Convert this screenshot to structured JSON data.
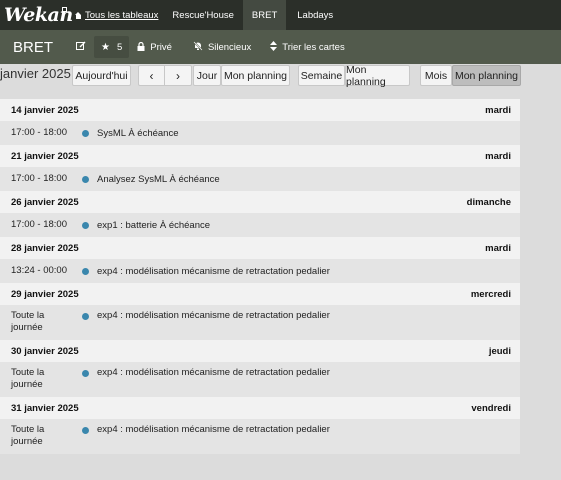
{
  "header": {
    "logo": "Wekan",
    "links": [
      {
        "label": "Tous les tableaux"
      },
      {
        "label": "Rescue'House"
      },
      {
        "label": "BRET"
      },
      {
        "label": "Labdays"
      }
    ]
  },
  "board": {
    "title": "BRET",
    "stars": "5",
    "private_label": "Privé",
    "silent_label": "Silencieux",
    "sort_label": "Trier les cartes"
  },
  "calendar": {
    "title": "janvier 2025",
    "today_label": "Aujourd'hui",
    "prev_icon": "chevron-left-icon",
    "next_icon": "chevron-right-icon",
    "day_label": "Jour",
    "week_label": "Semaine",
    "month_label": "Mois",
    "planning_label": "Mon planning"
  },
  "days": [
    {
      "date": "14 janvier 2025",
      "weekday": "mardi",
      "events": [
        {
          "time": "17:00 - 18:00",
          "title": "SysML À échéance"
        }
      ]
    },
    {
      "date": "21 janvier 2025",
      "weekday": "mardi",
      "events": [
        {
          "time": "17:00 - 18:00",
          "title": "Analysez SysML À échéance"
        }
      ]
    },
    {
      "date": "26 janvier 2025",
      "weekday": "dimanche",
      "events": [
        {
          "time": "17:00 - 18:00",
          "title": "exp1 : batterie À échéance"
        }
      ]
    },
    {
      "date": "28 janvier 2025",
      "weekday": "mardi",
      "events": [
        {
          "time": "13:24 - 00:00",
          "title": "exp4 : modélisation mécanisme de retractation pedalier"
        }
      ]
    },
    {
      "date": "29 janvier 2025",
      "weekday": "mercredi",
      "events": [
        {
          "time": "Toute la journée",
          "title": "exp4 : modélisation mécanisme de retractation pedalier"
        }
      ]
    },
    {
      "date": "30 janvier 2025",
      "weekday": "jeudi",
      "events": [
        {
          "time": "Toute la journée",
          "title": "exp4 : modélisation mécanisme de retractation pedalier"
        }
      ]
    },
    {
      "date": "31 janvier 2025",
      "weekday": "vendredi",
      "events": [
        {
          "time": "Toute la journée",
          "title": "exp4 : modélisation mécanisme de retractation pedalier"
        }
      ]
    }
  ],
  "colors": {
    "topbar": "#2b2f29",
    "boardbar": "#525a4c",
    "event_dot": "#3a87ad",
    "background": "#dcdcdc"
  }
}
